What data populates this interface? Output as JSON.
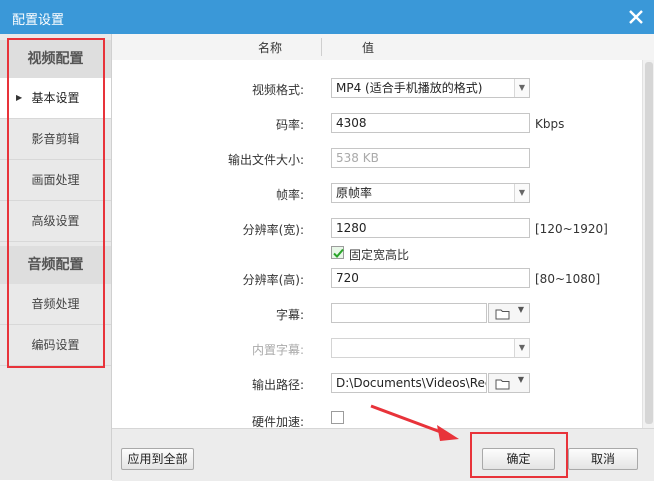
{
  "window": {
    "title": "配置设置"
  },
  "sidebar": {
    "group_video": "视频配置",
    "video_items": [
      "基本设置",
      "影音剪辑",
      "画面处理",
      "高级设置"
    ],
    "group_audio": "音频配置",
    "audio_items": [
      "音频处理",
      "编码设置"
    ]
  },
  "table_header": {
    "name": "名称",
    "value": "值"
  },
  "settings": {
    "video_format": {
      "label": "视频格式:",
      "value": "MP4 (适合手机播放的格式)"
    },
    "bitrate": {
      "label": "码率:",
      "value": "4308",
      "unit": "Kbps"
    },
    "output_size": {
      "label": "输出文件大小:",
      "value": "538 KB"
    },
    "framerate": {
      "label": "帧率:",
      "value": "原帧率"
    },
    "res_width": {
      "label": "分辨率(宽):",
      "value": "1280",
      "range": "[120~1920]"
    },
    "lock_aspect": {
      "label": "固定宽高比",
      "checked": true
    },
    "res_height": {
      "label": "分辨率(高):",
      "value": "720",
      "range": "[80~1080]"
    },
    "subtitle": {
      "label": "字幕:",
      "value": ""
    },
    "embedded_subtitle": {
      "label": "内置字幕:",
      "value": ""
    },
    "output_path": {
      "label": "输出路径:",
      "value": "D:\\Documents\\Videos\\Reco"
    },
    "hw_accel": {
      "label": "硬件加速:",
      "checked": false
    }
  },
  "footer": {
    "apply_all": "应用到全部",
    "ok": "确定",
    "cancel": "取消"
  },
  "colors": {
    "titlebar": "#3a98d8",
    "highlight": "#e8333a"
  }
}
